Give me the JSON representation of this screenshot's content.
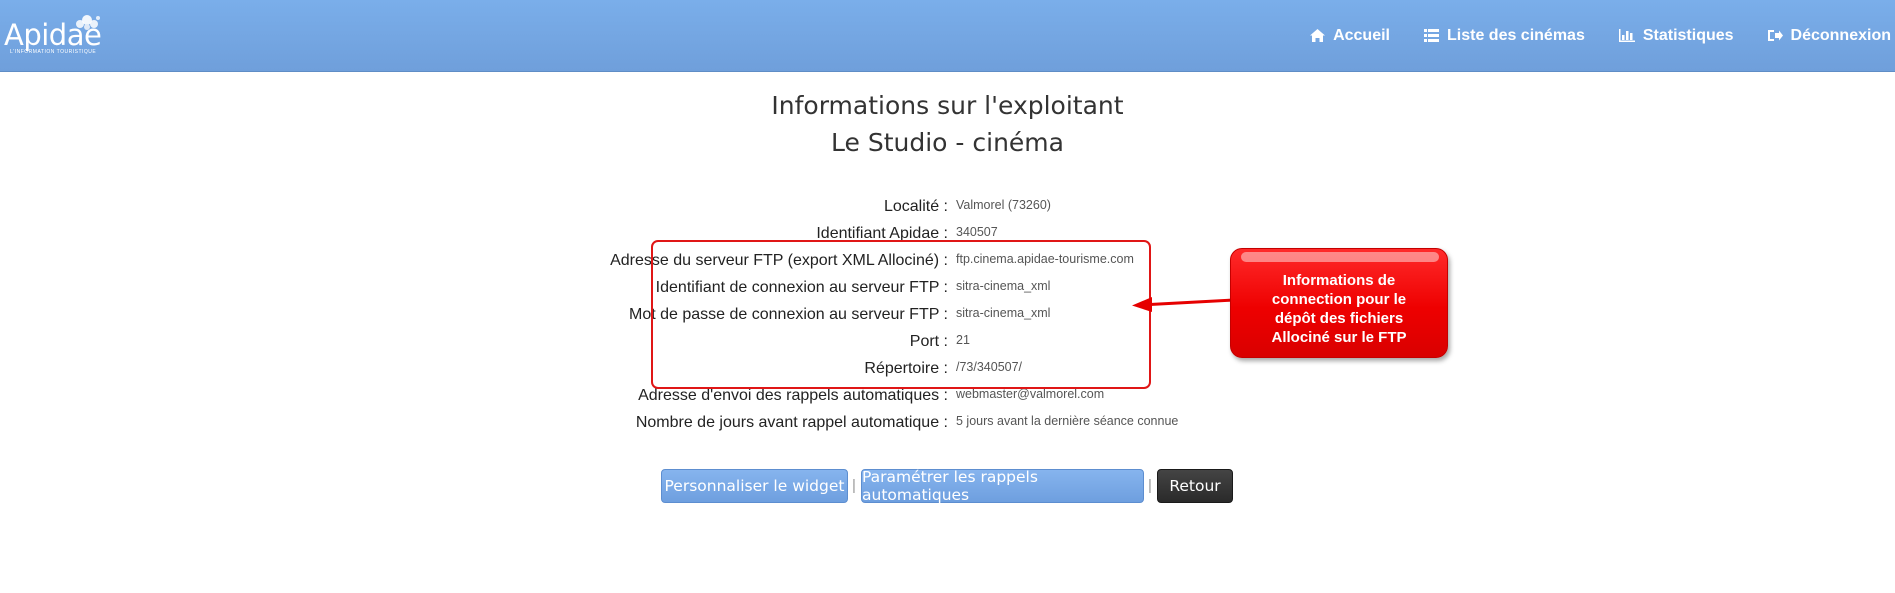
{
  "brand": {
    "logo_text": "Apidae",
    "logo_subtitle": "L'INFORMATION TOURISTIQUE"
  },
  "nav": {
    "items": [
      {
        "label": "Accueil",
        "icon": "home-icon"
      },
      {
        "label": "Liste des cinémas",
        "icon": "list-icon"
      },
      {
        "label": "Statistiques",
        "icon": "bar-chart-icon"
      },
      {
        "label": "Déconnexion",
        "icon": "sign-out-icon"
      }
    ]
  },
  "page": {
    "title": "Informations sur l'exploitant",
    "subtitle": "Le Studio - cinéma"
  },
  "info": {
    "rows": [
      {
        "label": "Localité :",
        "value": "Valmorel (73260)"
      },
      {
        "label": "Identifiant Apidae :",
        "value": "340507"
      },
      {
        "label": "Adresse du serveur FTP (export XML Allociné) :",
        "value": "ftp.cinema.apidae-tourisme.com"
      },
      {
        "label": "Identifiant de connexion au serveur FTP :",
        "value": "sitra-cinema_xml"
      },
      {
        "label": "Mot de passe de connexion au serveur FTP :",
        "value": "sitra-cinema_xml"
      },
      {
        "label": "Port :",
        "value": "21"
      },
      {
        "label": "Répertoire :",
        "value": "/73/340507/"
      },
      {
        "label": "Adresse d'envoi des rappels automatiques :",
        "value": "webmaster@valmorel.com"
      },
      {
        "label": "Nombre de jours avant rappel automatique :",
        "value": "5 jours avant la dernière séance connue"
      }
    ]
  },
  "annotation": {
    "text": "Informations de connection pour le dépôt des fichiers Allociné sur le FTP",
    "color": "#e60000"
  },
  "actions": {
    "customize_widget": "Personnaliser le widget",
    "configure_reminders": "Paramétrer les rappels automatiques",
    "back": "Retour",
    "separator": "|"
  },
  "colors": {
    "navbar": "#76a8e6",
    "button_primary": "#77a6e5",
    "button_dark": "#333333",
    "highlight": "#e01616"
  }
}
